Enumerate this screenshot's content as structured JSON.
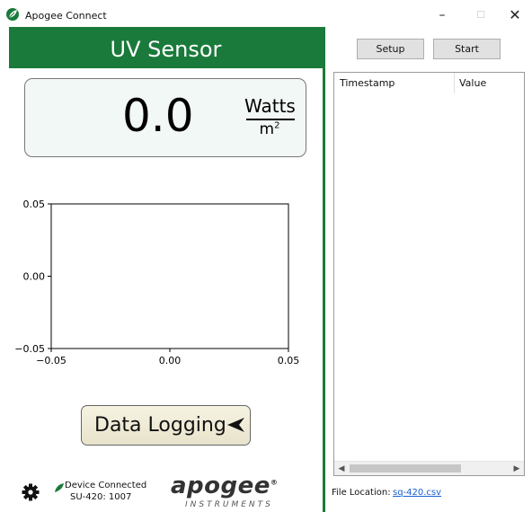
{
  "window": {
    "title": "Apogee Connect",
    "minimize": "–",
    "maximize": "☐",
    "close": "✕"
  },
  "sensor": {
    "header": "UV Sensor",
    "reading": "0.0",
    "unit_top": "Watts",
    "unit_bottom": "m",
    "unit_exponent": "2"
  },
  "chart_data": {
    "type": "line",
    "series": [],
    "xlim": [
      -0.05,
      0.05
    ],
    "ylim": [
      -0.05,
      0.05
    ],
    "x_tick_labels": [
      "−0.05",
      "0.00",
      "0.05"
    ],
    "y_tick_labels": [
      "0.05",
      "0.00",
      "−0.05"
    ],
    "title": "",
    "xlabel": "",
    "ylabel": "",
    "grid": false
  },
  "logging": {
    "label": "Data Logging"
  },
  "status": {
    "line1": "Device Connected",
    "line2": "SU-420: 1007",
    "connected_color": "#1a7a3b"
  },
  "logo": {
    "word": "apogee",
    "mark": "®",
    "subtitle": "INSTRUMENTS"
  },
  "toolbar": {
    "setup_label": "Setup",
    "start_label": "Start"
  },
  "table": {
    "columns": [
      "Timestamp",
      "Value"
    ],
    "rows": []
  },
  "file": {
    "label": "File Location:",
    "link": "sq-420.csv"
  },
  "colors": {
    "accent": "#1a7a3b",
    "link": "#1a5fd0"
  },
  "icons": {
    "app": "leaf-icon",
    "settings": "gear-icon",
    "status": "leaf-icon",
    "logging": "arrow-left-icon"
  }
}
